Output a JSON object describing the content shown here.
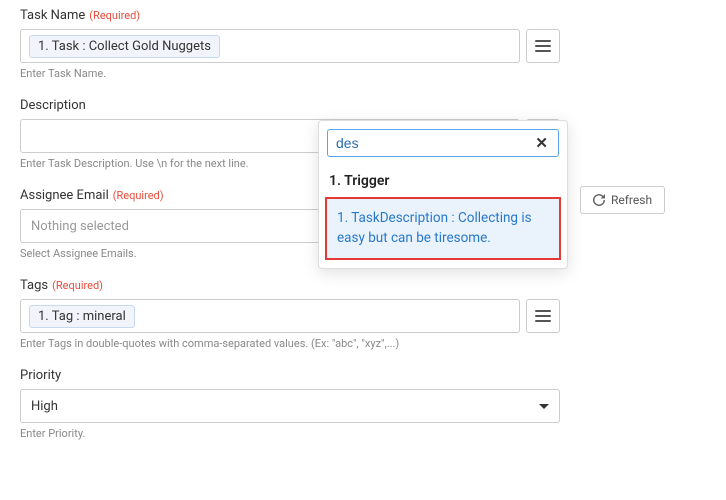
{
  "fields": {
    "taskName": {
      "label": "Task Name",
      "required": "(Required)",
      "chip": "1. Task : Collect Gold Nuggets",
      "helper": "Enter Task Name."
    },
    "description": {
      "label": "Description",
      "value": "",
      "helper": "Enter Task Description. Use \\n for the next line."
    },
    "assigneeEmail": {
      "label": "Assignee Email",
      "required": "(Required)",
      "placeholder": "Nothing selected",
      "helper": "Select Assignee Emails."
    },
    "tags": {
      "label": "Tags",
      "required": "(Required)",
      "chip": "1. Tag : mineral",
      "helper": "Enter Tags in double-quotes with comma-separated values. (Ex: \"abc\", \"xyz\",...)"
    },
    "priority": {
      "label": "Priority",
      "value": "High",
      "helper": "Enter Priority."
    }
  },
  "refreshLabel": "Refresh",
  "popover": {
    "searchValue": "des",
    "heading": "1. Trigger",
    "itemText": "1. TaskDescription : Collecting is easy but can be tiresome."
  }
}
